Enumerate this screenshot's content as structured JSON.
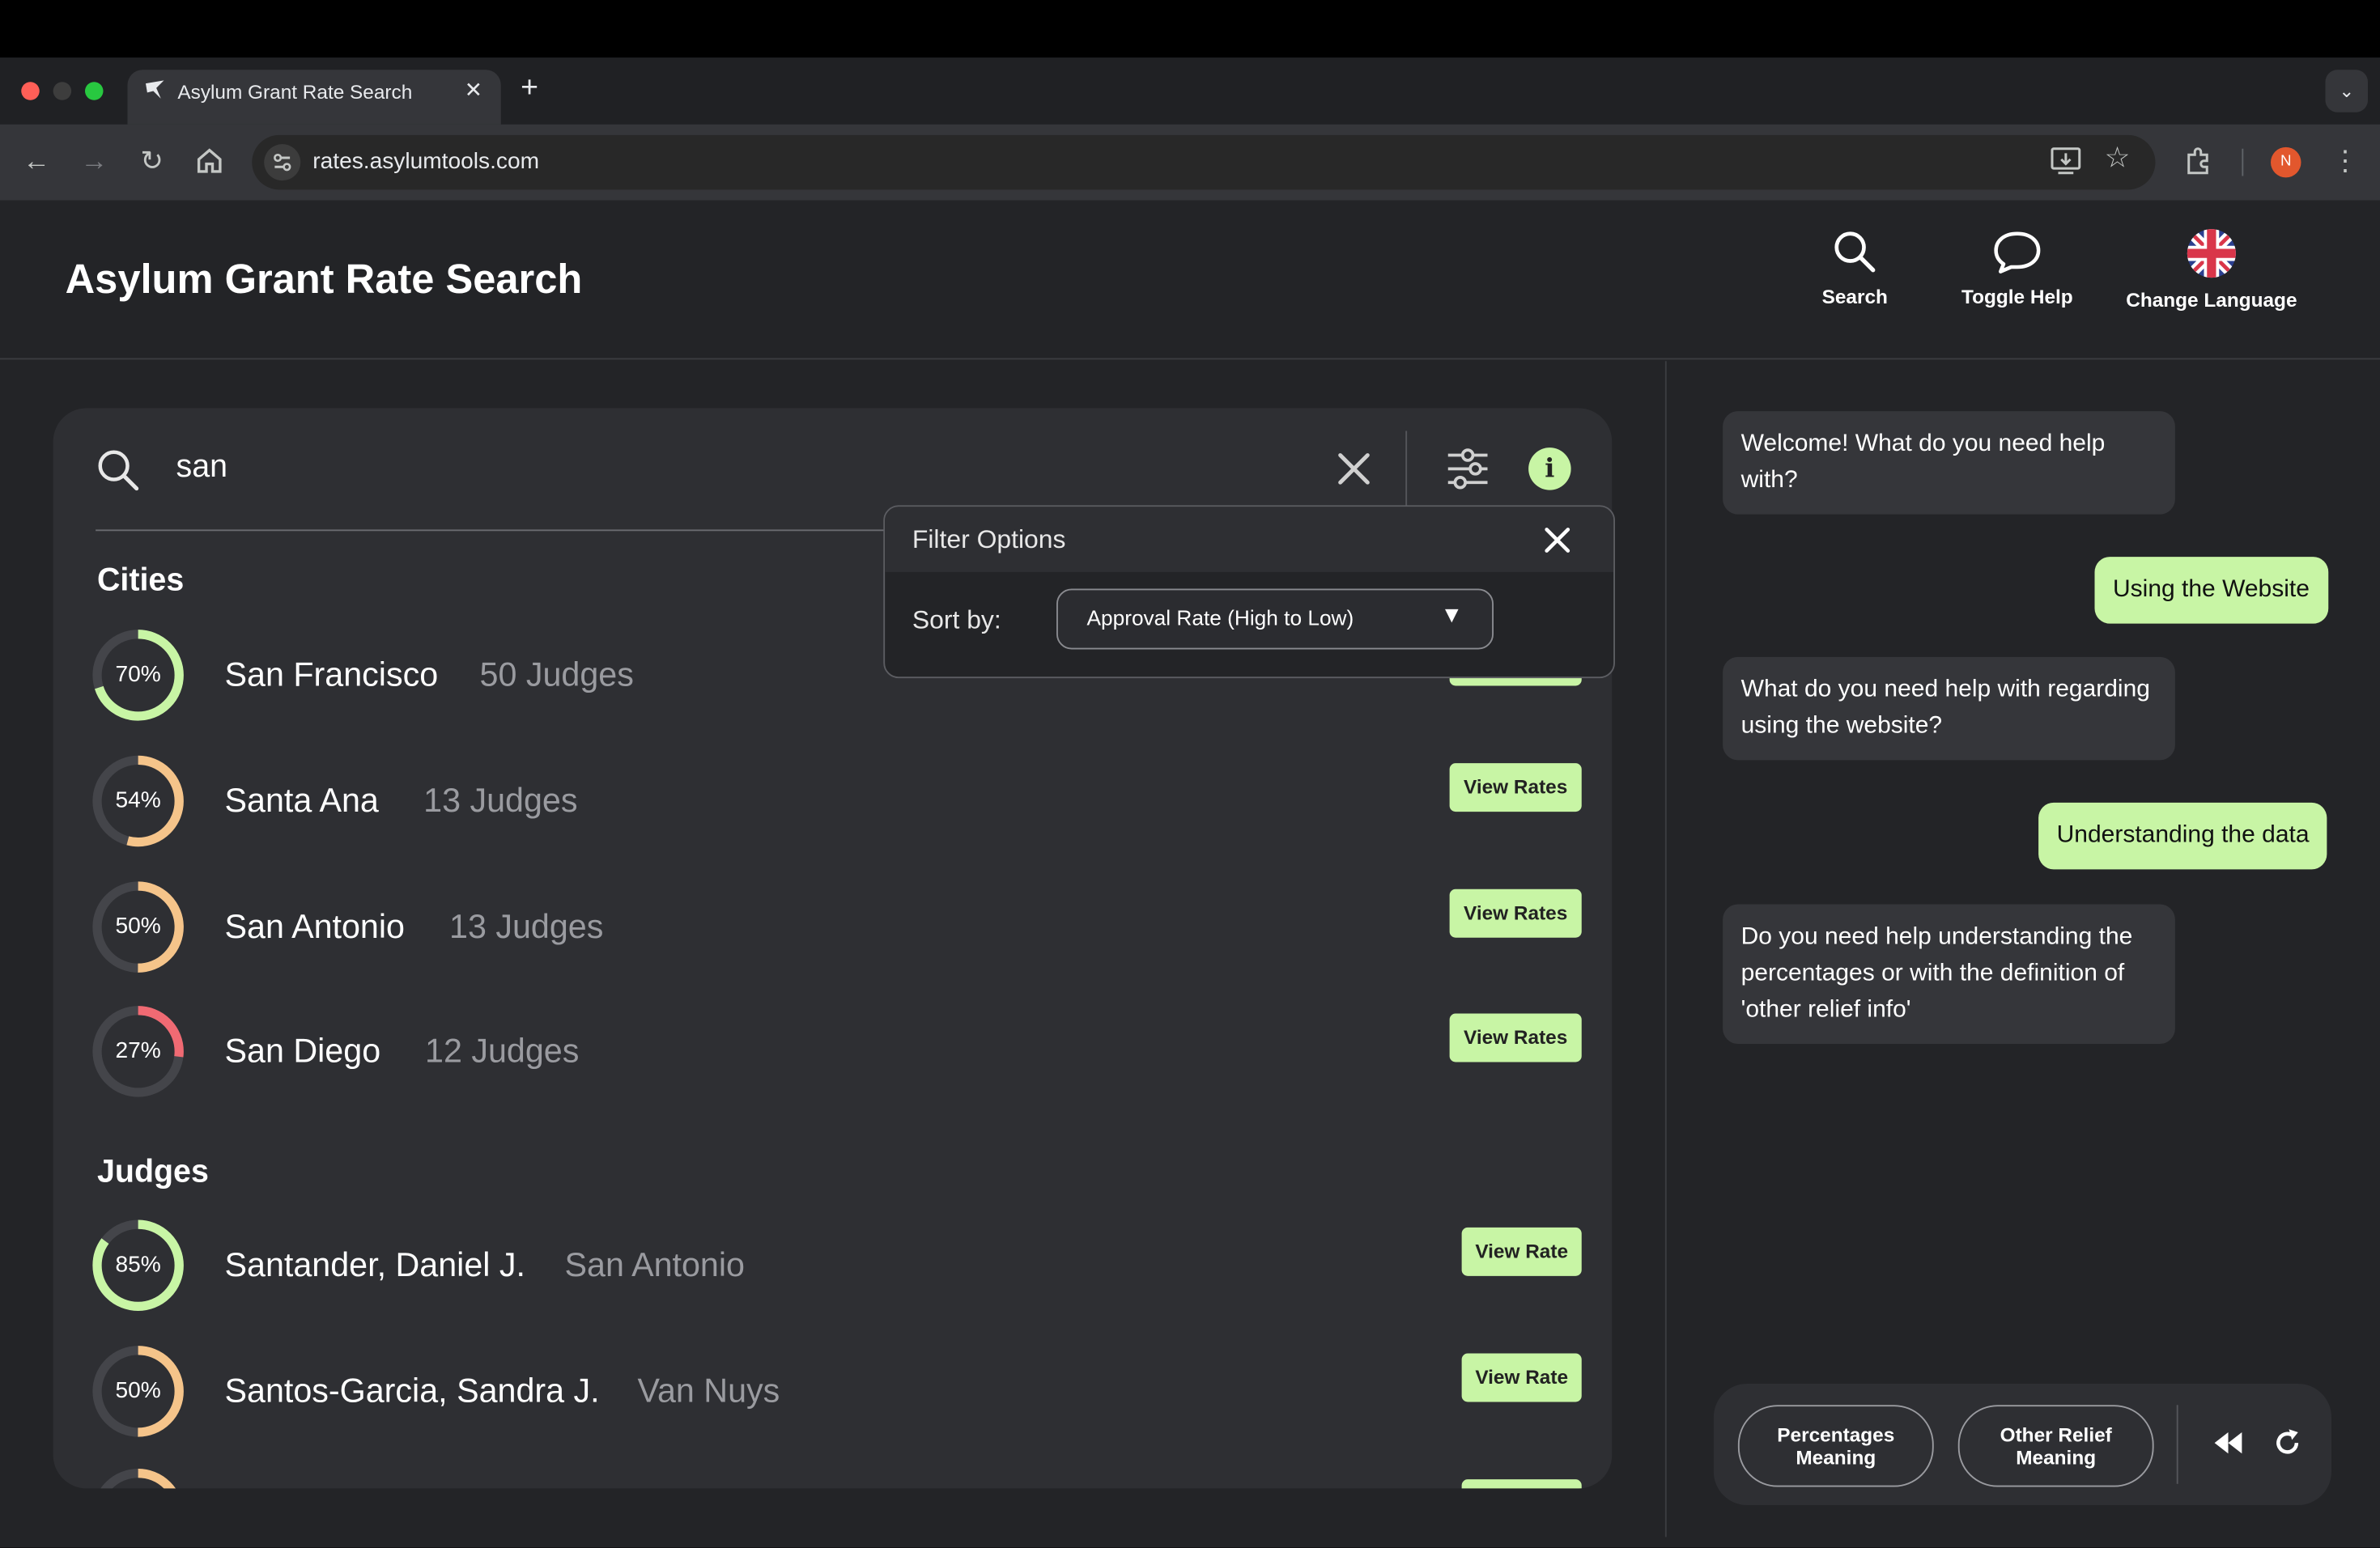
{
  "browser": {
    "tab_title": "Asylum Grant Rate Search",
    "url": "rates.asylumtools.com",
    "profile_initial": "N"
  },
  "app": {
    "title": "Asylum Grant Rate Search",
    "header_buttons": {
      "search": "Search",
      "help": "Toggle Help",
      "language": "Change Language"
    }
  },
  "search": {
    "query": "san"
  },
  "filter": {
    "title": "Filter Options",
    "sort_label": "Sort by:",
    "sort_value": "Approval Rate (High to Low)"
  },
  "cities": {
    "title": "Cities",
    "items": [
      {
        "pct_label": "70%",
        "pct": 70,
        "name": "San Francisco",
        "sub": "50 Judges",
        "button": "View Rates",
        "color": "#c8f5a5"
      },
      {
        "pct_label": "54%",
        "pct": 54,
        "name": "Santa Ana",
        "sub": "13 Judges",
        "button": "View Rates",
        "color": "#f5c48a"
      },
      {
        "pct_label": "50%",
        "pct": 50,
        "name": "San Antonio",
        "sub": "13 Judges",
        "button": "View Rates",
        "color": "#f5c48a"
      },
      {
        "pct_label": "27%",
        "pct": 27,
        "name": "San Diego",
        "sub": "12 Judges",
        "button": "View Rates",
        "color": "#f06a73"
      }
    ]
  },
  "judges": {
    "title": "Judges",
    "items": [
      {
        "pct_label": "85%",
        "pct": 85,
        "name": "Santander, Daniel J.",
        "sub": "San Antonio",
        "button": "View Rate",
        "color": "#c8f5a5"
      },
      {
        "pct_label": "50%",
        "pct": 50,
        "name": "Santos-Garcia, Sandra J.",
        "sub": "Van Nuys",
        "button": "View Rate",
        "color": "#f5c48a"
      }
    ]
  },
  "chat": {
    "messages": [
      {
        "from": "bot",
        "text": "Welcome! What do you need help with?"
      },
      {
        "from": "user",
        "text": "Using the Website"
      },
      {
        "from": "bot",
        "text": "What do you need help with regarding using the website?"
      },
      {
        "from": "user",
        "text": "Understanding the data"
      },
      {
        "from": "bot",
        "text": "Do you need help understanding the percentages or with the definition of 'other relief info'"
      }
    ],
    "quick_replies": [
      "Percentages Meaning",
      "Other Relief Meaning"
    ]
  },
  "colors": {
    "accent": "#c8f5a5",
    "mid": "#f5c48a",
    "low": "#f06a73",
    "ring_track": "#44454a"
  }
}
